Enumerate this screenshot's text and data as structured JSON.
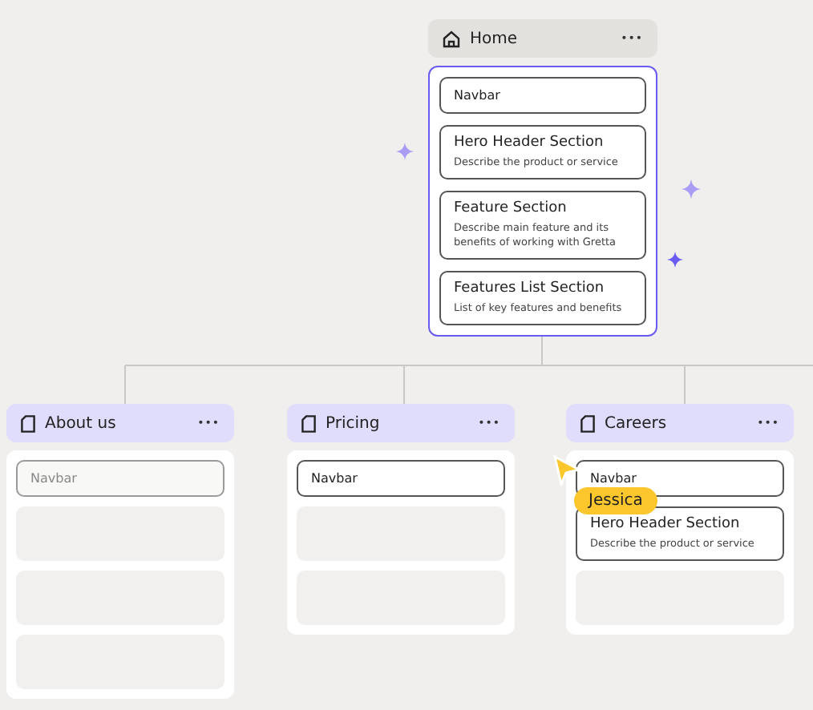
{
  "root": {
    "title": "Home",
    "menu": "•••",
    "blocks": [
      {
        "kind": "simple",
        "title": "Navbar"
      },
      {
        "kind": "section",
        "title": "Hero Header Section",
        "description": "Describe the product or service"
      },
      {
        "kind": "section",
        "title": "Feature Section",
        "description": "Describe main feature and its benefits of working with Gretta"
      },
      {
        "kind": "section",
        "title": "Features List Section",
        "description": "List of key features and benefits"
      }
    ]
  },
  "pages": [
    {
      "title": "About us",
      "menu": "•••",
      "blocks": [
        {
          "kind": "ghost",
          "title": "Navbar"
        },
        {
          "kind": "placeholder"
        },
        {
          "kind": "placeholder"
        },
        {
          "kind": "placeholder"
        }
      ]
    },
    {
      "title": "Pricing",
      "menu": "•••",
      "blocks": [
        {
          "kind": "simple",
          "title": "Navbar"
        },
        {
          "kind": "placeholder"
        },
        {
          "kind": "placeholder"
        }
      ]
    },
    {
      "title": "Careers",
      "menu": "•••",
      "blocks": [
        {
          "kind": "simple",
          "title": "Navbar"
        },
        {
          "kind": "section",
          "title": "Hero Header Section",
          "description": "Describe the product or service"
        },
        {
          "kind": "placeholder"
        }
      ]
    }
  ],
  "cursor": {
    "name": "Jessica"
  }
}
